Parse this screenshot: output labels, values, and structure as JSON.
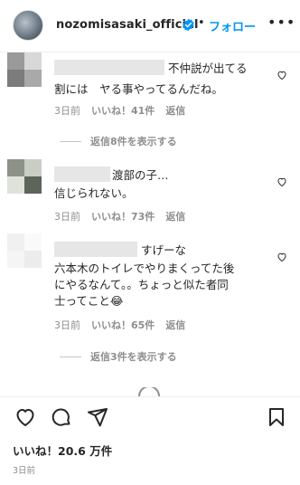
{
  "header": {
    "username": "nozomisasaki_official",
    "separator": "•",
    "follow_label": "フォロー",
    "more_label": "•••"
  },
  "comments": [
    {
      "line1": "不仲説が出てる",
      "line2": "割には　ヤる事やってるんだね。",
      "time": "3日前",
      "likes": "いいね！41件",
      "reply": "返信",
      "view_replies": "返信8件を表示する",
      "avatar_colors": [
        "#9a9a9a",
        "#d8d8d8",
        "#7c7c7c",
        "#a9a9a9"
      ]
    },
    {
      "line1": "渡部の子…",
      "line2": "信じられない。",
      "time": "3日前",
      "likes": "いいね！73件",
      "reply": "返信",
      "avatar_colors": [
        "#8c9288",
        "#c9cec4",
        "#dfe2db",
        "#5d645a"
      ]
    },
    {
      "line1": "すげーな",
      "line2": "六本木のトイレでやりまくってた後",
      "line3": "にやるなんて。。ちょっと似た者同",
      "line4": "士ってこと😂",
      "time": "3日前",
      "likes": "いいね！65件",
      "reply": "返信",
      "view_replies": "返信3件を表示する",
      "avatar_colors": [
        "#f0f0f0",
        "#fafafa",
        "#f5f5f5",
        "#ececec"
      ]
    }
  ],
  "footer": {
    "likes": "いいね！20.6 万件",
    "date": "3日前"
  },
  "colors": {
    "link_blue": "#0095f6",
    "muted": "#8e8e8e",
    "text": "#262626"
  },
  "icons": [
    "verified-badge-icon",
    "heart-icon",
    "comment-icon",
    "share-icon",
    "bookmark-icon"
  ]
}
